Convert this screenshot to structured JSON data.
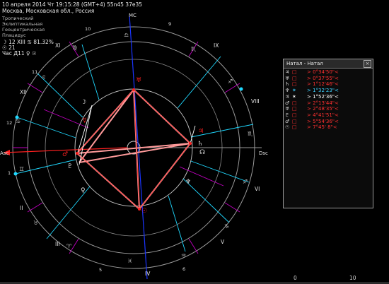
{
  "header": {
    "line1": "10 апреля 2014  Чт  19:15:28 (GMT+4)  55n45  37e35",
    "line2": "Москва, Московская обл., Россия",
    "line3": "Тропический",
    "line4": "Эклиптикальная",
    "line5": "Геоцентрическая",
    "line6": "Плацидус",
    "moon_info": "☽  12 XIII  ♋  81.32%",
    "sun_info": "☉  21",
    "hour_info": "Час Д11  ♀  ☉"
  },
  "chart": {
    "mc_label": "MC",
    "asc_label": "Asc",
    "dsc_label": "Dsc",
    "house_numbers": [
      "I",
      "II",
      "III",
      "IV",
      "V",
      "VI",
      "VII",
      "VIII",
      "IX",
      "X",
      "XI",
      "XII"
    ],
    "degree_labels": [
      "10",
      "9",
      "8",
      "7",
      "6",
      "5",
      "4",
      "3",
      "2",
      "1",
      "12",
      "11"
    ]
  },
  "aspect_window": {
    "title": "Натал - Натал",
    "close_glyph": "×",
    "rows": [
      {
        "p1": "♃",
        "p2": "□",
        "orb": "> 0°34'50\"<",
        "color": "#ff3030"
      },
      {
        "p1": "♅",
        "p2": "□",
        "orb": "> 0°37'55\"<",
        "color": "#ff3030"
      },
      {
        "p1": "♄",
        "p2": "□",
        "orb": "> 1°12'46\"<",
        "color": "#ff3030"
      },
      {
        "p1": "♆",
        "p2": "✶",
        "orb": "> 1°32'23\"<",
        "color": "#3fd0ff"
      },
      {
        "p1": "♃",
        "p2": "✶",
        "orb": "> 1°52'36\"<",
        "color": "#ffffff"
      },
      {
        "p1": "♂",
        "p2": "□",
        "orb": "> 2°13'44\"<",
        "color": "#ff3030"
      },
      {
        "p1": "♅",
        "p2": "□",
        "orb": "> 2°48'35\"<",
        "color": "#ff3030"
      },
      {
        "p1": "♇",
        "p2": "□",
        "orb": "> 4°41'51\"<",
        "color": "#ff3030"
      },
      {
        "p1": "♂",
        "p2": "□",
        "orb": "> 5°54'36\"<",
        "color": "#ff3030"
      },
      {
        "p1": "☉",
        "p2": "□",
        "orb": "> 7°45' 8\"<",
        "color": "#ff3030"
      }
    ]
  },
  "footer": {
    "n1": "0",
    "n2": "10"
  },
  "colors": {
    "red": "#ff2020",
    "cyan": "#1fd8ff",
    "magenta": "#c000c0",
    "blue": "#1a35ff",
    "pink": "#ff9a9a",
    "ring": "#aaaaaa"
  }
}
